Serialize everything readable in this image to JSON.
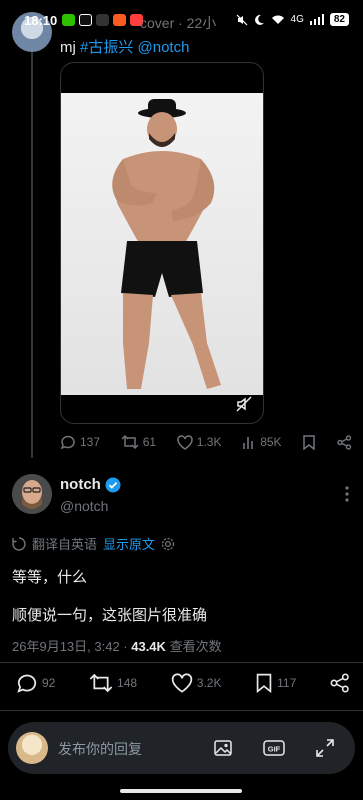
{
  "status_bar": {
    "time": "18:10",
    "behind_text": "cover · 22小",
    "network": "4G",
    "battery": "82"
  },
  "quoted_post": {
    "text_prefix": "mj",
    "hashtag": "#古振兴",
    "mention": "@notch",
    "actions": {
      "replies": "137",
      "reposts": "61",
      "likes": "1.3K",
      "views": "85K"
    }
  },
  "main_post": {
    "author_name": "notch",
    "author_handle": "@notch",
    "translate_label": "翻译自英语",
    "show_original": "显示原文",
    "line1": "等等，什么",
    "line2": "顺便说一句，这张图片很准确",
    "timestamp": "26年9月13日, 3:42 · ",
    "view_count": "43.4K",
    "views_label": "查看次数",
    "actions": {
      "replies": "92",
      "reposts": "148",
      "likes": "3.2K",
      "bookmarks": "117"
    }
  },
  "reply_bar": {
    "placeholder": "发布你的回复"
  },
  "colors": {
    "background": "#000000",
    "accent": "#1d9bf0",
    "muted": "#71767b",
    "text": "#e7e9ea"
  }
}
